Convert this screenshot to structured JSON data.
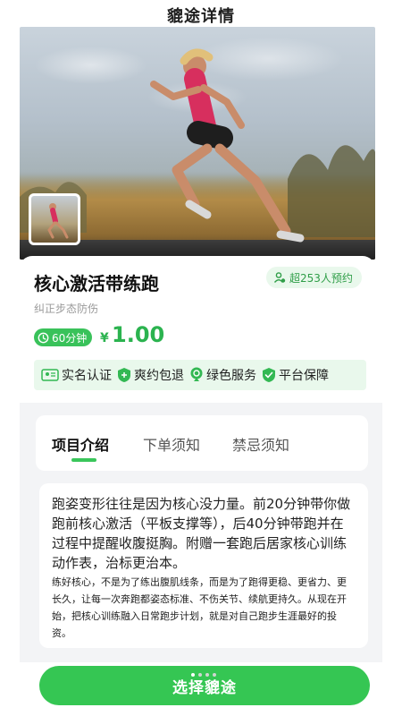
{
  "header": {
    "title": "貔途详情"
  },
  "product": {
    "title": "核心激活带练跑",
    "booking_badge": "超253人预约",
    "subtitle": "纠正步态防伤",
    "duration": "60分钟",
    "currency": "¥",
    "price": "1.00"
  },
  "features": [
    {
      "icon": "id-card-icon",
      "label": "实名认证"
    },
    {
      "icon": "refund-shield-icon",
      "label": "爽约包退"
    },
    {
      "icon": "leaf-badge-icon",
      "label": "绿色服务"
    },
    {
      "icon": "check-shield-icon",
      "label": "平台保障"
    }
  ],
  "tabs": [
    {
      "label": "项目介绍",
      "active": true
    },
    {
      "label": "下单须知",
      "active": false
    },
    {
      "label": "禁忌须知",
      "active": false
    }
  ],
  "description": {
    "main": "跑姿变形往往是因为核心没力量。前20分钟带你做跑前核心激活（平板支撑等），后40分钟带跑并在过程中提醒收腹挺胸。附赠一套跑后居家核心训练动作表，治标更治本。",
    "sub": "练好核心，不是为了练出腹肌线条，而是为了跑得更稳、更省力、更长久，让每一次奔跑都姿态标准、不伤关节、续航更持久。从现在开始，把核心训练融入日常跑步计划，就是对自己跑步生涯最好的投资。"
  },
  "cta": {
    "label": "选择貔途"
  },
  "colors": {
    "accent": "#35c653",
    "accent_light": "#e9f8ec",
    "price": "#2bb34f"
  }
}
